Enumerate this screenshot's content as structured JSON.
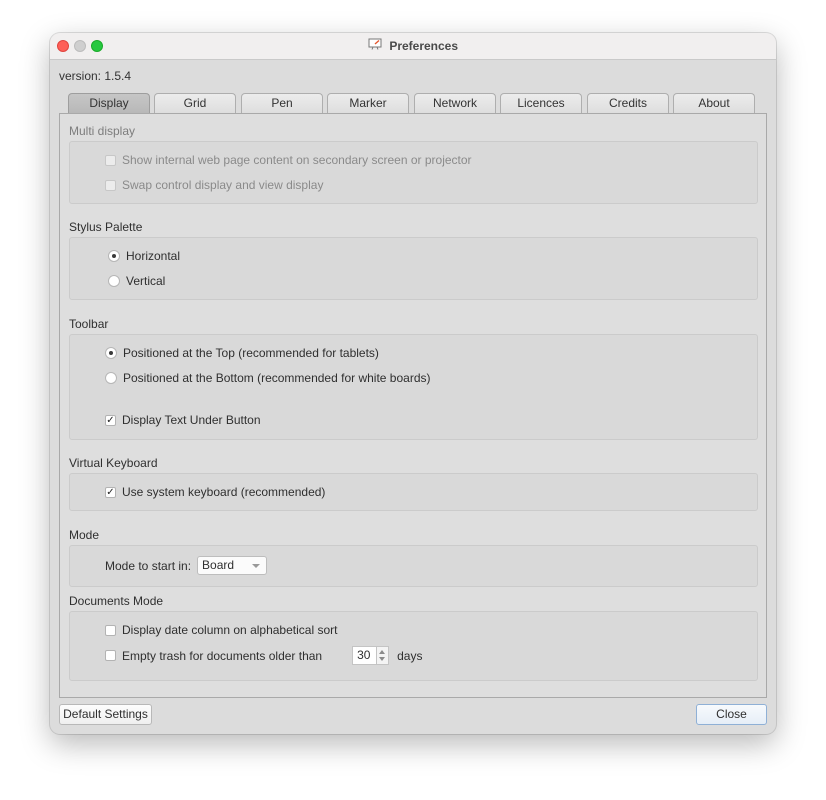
{
  "window": {
    "title": "Preferences",
    "title_icon": "presentation-board-icon"
  },
  "version_label": "version: 1.5.4",
  "tabs": [
    {
      "label": "Display",
      "active": true
    },
    {
      "label": "Grid",
      "active": false
    },
    {
      "label": "Pen",
      "active": false
    },
    {
      "label": "Marker",
      "active": false
    },
    {
      "label": "Network",
      "active": false
    },
    {
      "label": "Licences",
      "active": false
    },
    {
      "label": "Credits",
      "active": false
    },
    {
      "label": "About",
      "active": false
    }
  ],
  "sections": {
    "multi_display": {
      "title": "Multi display",
      "enabled": false,
      "options": [
        {
          "label": "Show internal web page content on secondary screen or projector",
          "checked": false
        },
        {
          "label": "Swap control display and view display",
          "checked": false
        }
      ]
    },
    "stylus_palette": {
      "title": "Stylus Palette",
      "options": [
        {
          "label": "Horizontal",
          "selected": true
        },
        {
          "label": "Vertical",
          "selected": false
        }
      ]
    },
    "toolbar": {
      "title": "Toolbar",
      "options": [
        {
          "label": "Positioned at the Top (recommended for tablets)",
          "selected": true
        },
        {
          "label": "Positioned at the Bottom (recommended for white boards)",
          "selected": false
        }
      ],
      "text_under_button": {
        "label": "Display Text Under Button",
        "checked": true
      }
    },
    "virtual_keyboard": {
      "title": "Virtual Keyboard",
      "system_keyboard": {
        "label": "Use system keyboard (recommended)",
        "checked": true
      }
    },
    "mode": {
      "title": "Mode",
      "start_label": "Mode to start in:",
      "start_value": "Board"
    },
    "documents_mode": {
      "title": "Documents Mode",
      "date_column": {
        "label": "Display date column on alphabetical sort",
        "checked": false
      },
      "empty_trash": {
        "label": "Empty trash for documents older than",
        "checked": false,
        "days_value": "30",
        "days_unit": "days"
      }
    }
  },
  "buttons": {
    "default_settings": "Default Settings",
    "close": "Close"
  },
  "check_glyph": "✓"
}
